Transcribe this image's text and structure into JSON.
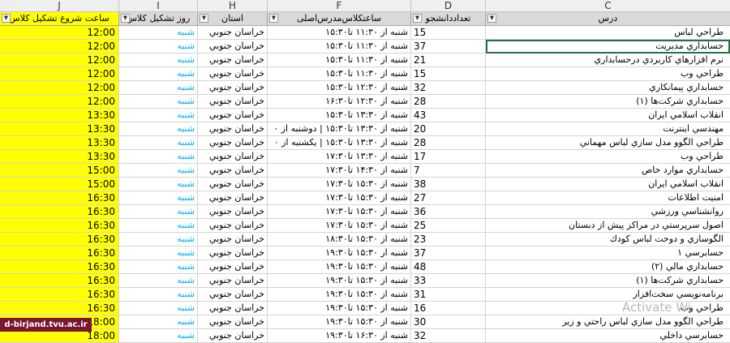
{
  "column_letters": {
    "J": "J",
    "I": "I",
    "H": "H",
    "F": "F",
    "D": "D",
    "C": "C"
  },
  "headers": {
    "J": "ساعت شروع تشکیل کلاس",
    "I": "روز تشکیل کلاس",
    "H": "استان",
    "F": "ساعتکلاس‌مدرس‌اصلی",
    "D": "تعداددانشجو",
    "C": "درس"
  },
  "rows": [
    {
      "J": "12:00",
      "I": "شنبه",
      "H": "خراسان جنوبي",
      "F": "شنبه از ۱۱:۳۰ تا۱۵:۳۰",
      "D": "15",
      "C": "طراحي لباس"
    },
    {
      "J": "12:00",
      "I": "شنبه",
      "H": "خراسان جنوبي",
      "F": "شنبه از ۱۱:۳۰ تا۱۵:۳۰",
      "D": "37",
      "C": "حسابداري مديريت"
    },
    {
      "J": "12:00",
      "I": "شنبه",
      "H": "خراسان جنوبي",
      "F": "شنبه از ۱۱:۳۰ تا۱۵:۳۰",
      "D": "21",
      "C": "نرم افزارهاي كاربردي درحسابداري"
    },
    {
      "J": "12:00",
      "I": "شنبه",
      "H": "خراسان جنوبي",
      "F": "شنبه از ۱۱:۳۰ تا۱۵:۳۰",
      "D": "15",
      "C": "طراحي وب"
    },
    {
      "J": "12:00",
      "I": "شنبه",
      "H": "خراسان جنوبي",
      "F": "شنبه از ۱۲:۳۰ تا۱۵:۳۰",
      "D": "32",
      "C": "حسابداري پيمانكاري"
    },
    {
      "J": "12:00",
      "I": "شنبه",
      "H": "خراسان جنوبي",
      "F": "شنبه از ۱۲:۳۰ تا۱۶:۳۰",
      "D": "28",
      "C": "حسابداري شركت‌ها (۱)"
    },
    {
      "J": "13:30",
      "I": "شنبه",
      "H": "خراسان جنوبي",
      "F": "شنبه از ۱۳:۳۰ تا۱۵:۳۰",
      "D": "43",
      "C": "انقلاب اسلامي ايران"
    },
    {
      "J": "13:30",
      "I": "شنبه",
      "H": "خراسان جنوبي",
      "F": "شنبه از ۱۳:۳۰ تا۱۵:۳۰ | دوشنبه از ۰",
      "D": "20",
      "C": "مهندسي اينترنت"
    },
    {
      "J": "13:30",
      "I": "شنبه",
      "H": "خراسان جنوبي",
      "F": "شنبه از ۱۳:۳۰ تا۱۵:۳۰ | يكشنبه از ۰",
      "D": "28",
      "C": "طراحي الگوو مدل سازي لباس مهماني"
    },
    {
      "J": "13:30",
      "I": "شنبه",
      "H": "خراسان جنوبي",
      "F": "شنبه از ۱۳:۳۰ تا۱۷:۳۰",
      "D": "17",
      "C": "طراحي وب"
    },
    {
      "J": "15:00",
      "I": "شنبه",
      "H": "خراسان جنوبي",
      "F": "شنبه از ۱۴:۳۰ تا۱۷:۳۰",
      "D": "7",
      "C": "حسابداري موارد خاص"
    },
    {
      "J": "15:00",
      "I": "شنبه",
      "H": "خراسان جنوبي",
      "F": "شنبه از ۱۵:۳۰ تا۱۷:۳۰",
      "D": "38",
      "C": "انقلاب اسلامي ايران"
    },
    {
      "J": "16:30",
      "I": "شنبه",
      "H": "خراسان جنوبي",
      "F": "شنبه از ۱۵:۳۰ تا۱۷:۳۰",
      "D": "27",
      "C": "امنيت اطلاعات"
    },
    {
      "J": "16:30",
      "I": "شنبه",
      "H": "خراسان جنوبي",
      "F": "شنبه از ۱۵:۳۰ تا۱۷:۳۰",
      "D": "36",
      "C": "روانشناسي ورزشي"
    },
    {
      "J": "16:30",
      "I": "شنبه",
      "H": "خراسان جنوبي",
      "F": "شنبه از ۱۵:۳۰ تا۱۷:۳۰",
      "D": "25",
      "C": "اصول سرپرستي در مراكز پيش از دبستان"
    },
    {
      "J": "16:30",
      "I": "شنبه",
      "H": "خراسان جنوبي",
      "F": "شنبه از ۱۵:۳۰ تا۱۸:۳۰",
      "D": "23",
      "C": "الگوسازي و دوخت لباس كودك"
    },
    {
      "J": "16:30",
      "I": "شنبه",
      "H": "خراسان جنوبي",
      "F": "شنبه از ۱۵:۳۰ تا۱۹:۳۰",
      "D": "37",
      "C": "حسابرسي ۱"
    },
    {
      "J": "16:30",
      "I": "شنبه",
      "H": "خراسان جنوبي",
      "F": "شنبه از ۱۵:۳۰ تا۱۹:۳۰",
      "D": "48",
      "C": "حسابداري مالي (۲)"
    },
    {
      "J": "16:30",
      "I": "شنبه",
      "H": "خراسان جنوبي",
      "F": "شنبه از ۱۵:۳۰ تا۱۹:۳۰",
      "D": "33",
      "C": "حسابداري شركت‌ها (۱)"
    },
    {
      "J": "16:30",
      "I": "شنبه",
      "H": "خراسان جنوبي",
      "F": "شنبه از ۱۵:۳۰ تا۱۹:۳۰",
      "D": "31",
      "C": "برنامه‌نويسي سخت‌افزار"
    },
    {
      "J": "16:30",
      "I": "شنبه",
      "H": "خراسان جنوبي",
      "F": "شنبه از ۱۵:۳۰ تا۱۹:۳۰",
      "D": "16",
      "C": "طراحي وب"
    },
    {
      "J": "18:00",
      "I": "شنبه",
      "H": "خراسان جنوبي",
      "F": "شنبه از ۱۵:۳۰ تا۱۹:۳۰",
      "D": "30",
      "C": "طراحي الگوو مدل سازي لباس راحتي و زير"
    },
    {
      "J": "18:00",
      "I": "شنبه",
      "H": "خراسان جنوبي",
      "F": "شنبه از ۱۶:۳۰ تا۱۹:۳۰",
      "D": "32",
      "C": "حسابرسي داخلي"
    }
  ],
  "selected_row_index": 1,
  "overlay": {
    "activate_windows": "Activate Wi",
    "logo_text": "d-birjand.tvu.ac.ir"
  },
  "colors": {
    "highlight": "#ffff00",
    "day_text": "#00b0f0",
    "header_bg": "#d9d9d9",
    "selection": "#217346"
  }
}
